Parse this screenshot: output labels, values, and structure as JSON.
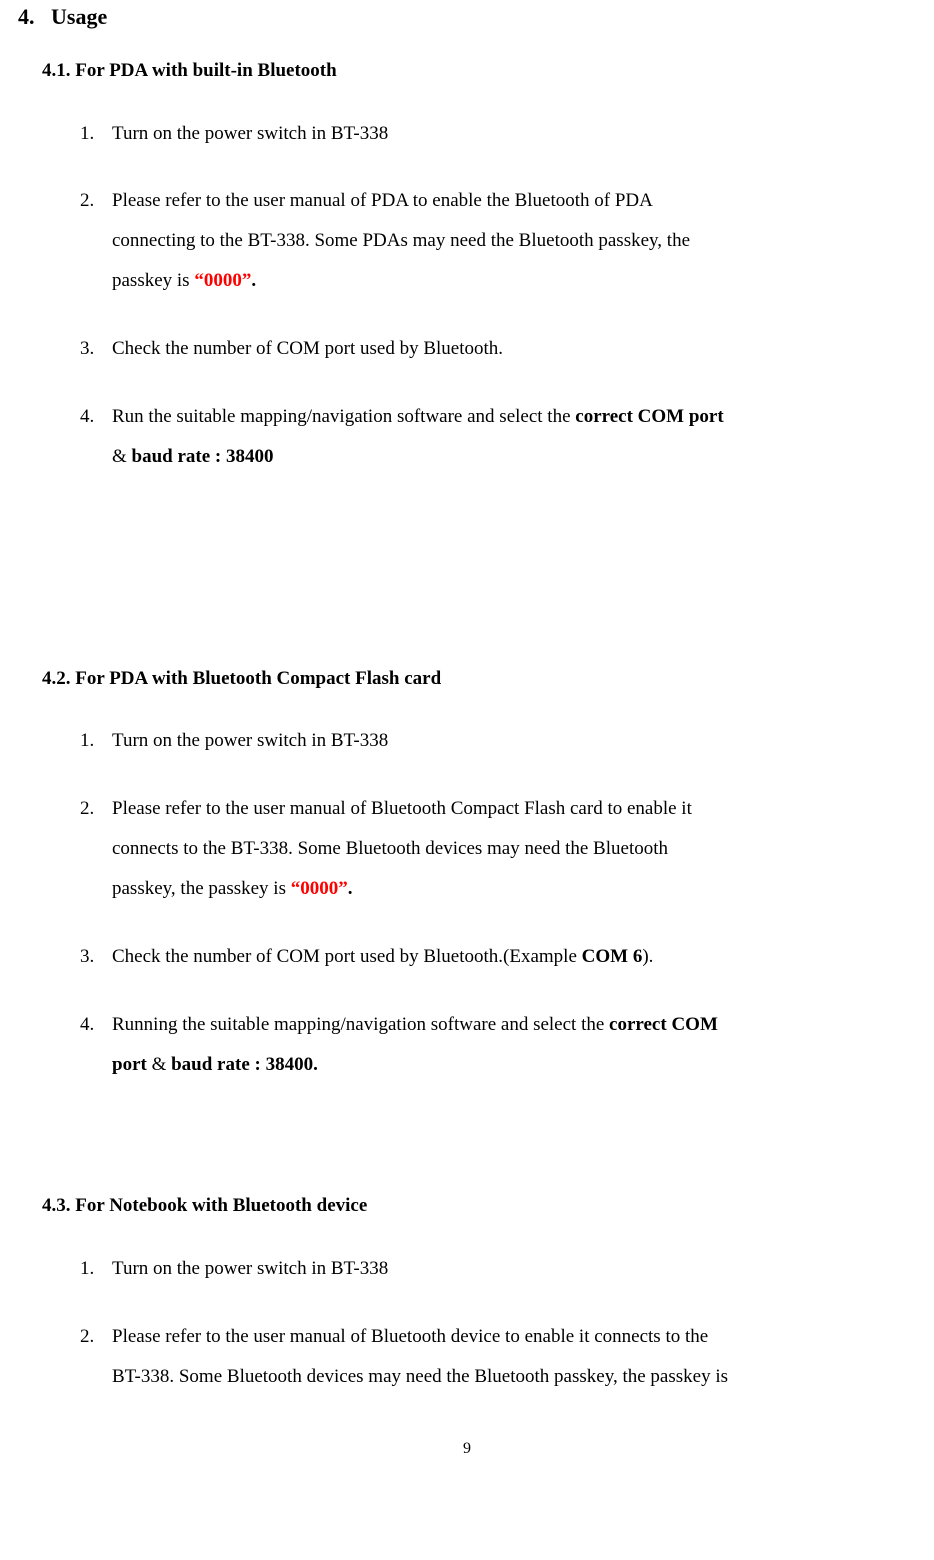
{
  "section": {
    "number": "4.",
    "title": "Usage"
  },
  "sub1": {
    "heading": "4.1. For PDA with built-in Bluetooth",
    "items": {
      "n1": "1.",
      "t1": "Turn on the power switch in BT-338",
      "n2": "2.",
      "t2a": "Please refer to the user manual of PDA to enable the Bluetooth of PDA",
      "t2b": "connecting to the BT-338. Some PDAs may need the Bluetooth passkey, the",
      "t2c_pre": "passkey is ",
      "t2c_red": "“0000”",
      "t2c_post": ".",
      "n3": "3.",
      "t3": "Check the number of COM port used by Bluetooth.",
      "n4": "4.",
      "t4a_pre": "Run the suitable mapping/navigation software and select the ",
      "t4a_bold": "correct COM port",
      "t4b_amp": "& ",
      "t4b_bold": "baud rate : 38400"
    }
  },
  "sub2": {
    "heading": "4.2. For PDA with Bluetooth Compact Flash card",
    "items": {
      "n1": "1.",
      "t1": "Turn on the power switch in BT-338",
      "n2": "2.",
      "t2a": "Please refer to the user manual of Bluetooth Compact Flash card to enable it",
      "t2b": "connects to the BT-338. Some Bluetooth devices may need the Bluetooth",
      "t2c_pre": "passkey, the passkey is ",
      "t2c_red": "“0000”",
      "t2c_post": ".",
      "n3": "3.",
      "t3_pre": "Check the number of COM port used by Bluetooth.(Example ",
      "t3_bold": "COM 6",
      "t3_post": ").",
      "n4": "4.",
      "t4a_pre": "Running the suitable mapping/navigation software and select the ",
      "t4a_bold": "correct COM",
      "t4b_bold1": "port",
      "t4b_amp": " & ",
      "t4b_bold2": "baud rate : 38400."
    }
  },
  "sub3": {
    "heading": "4.3. For Notebook with Bluetooth device",
    "items": {
      "n1": "1.",
      "t1": "Turn on the power switch in BT-338",
      "n2": "2.",
      "t2a": "Please refer to the user manual of Bluetooth device to enable it connects to the",
      "t2b": "BT-338. Some Bluetooth devices may need the Bluetooth passkey, the passkey is"
    }
  },
  "page_number": "9"
}
